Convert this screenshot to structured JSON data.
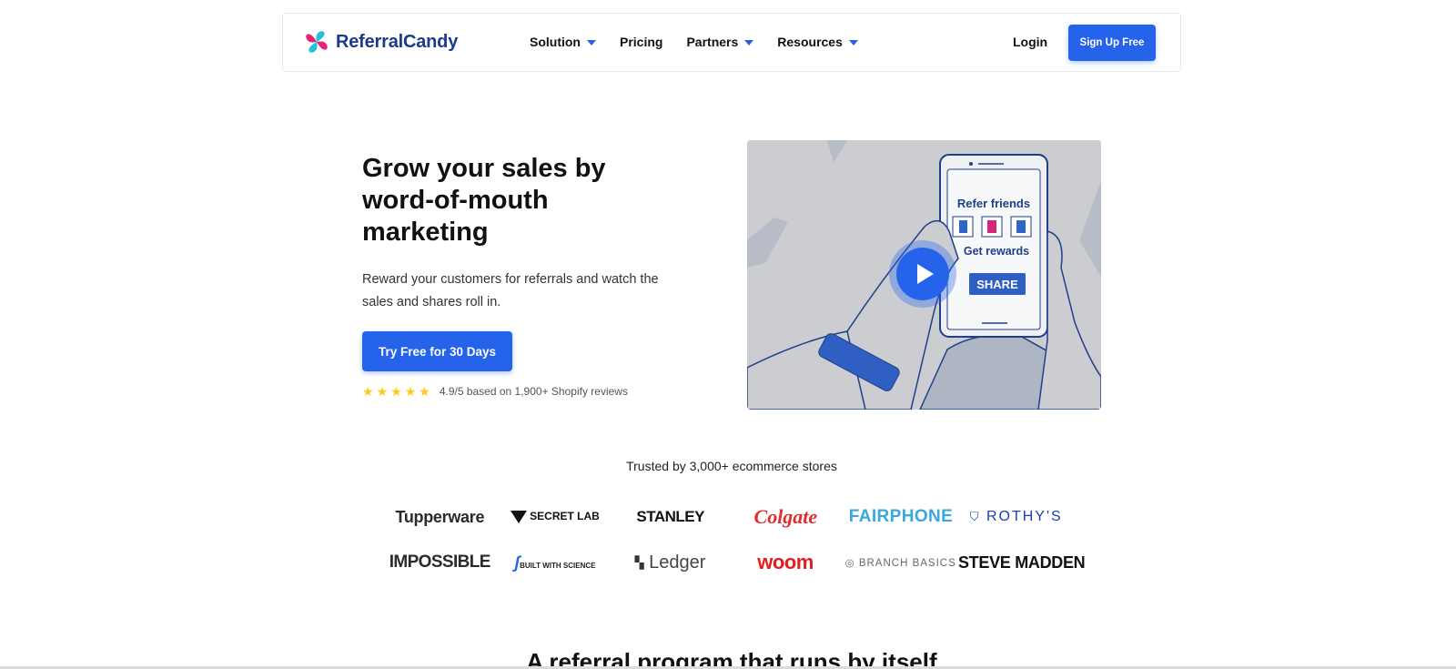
{
  "brand": {
    "name": "ReferralCandy"
  },
  "nav": {
    "items": [
      {
        "label": "Solution",
        "dropdown": true
      },
      {
        "label": "Pricing",
        "dropdown": false
      },
      {
        "label": "Partners",
        "dropdown": true
      },
      {
        "label": "Resources",
        "dropdown": true
      }
    ],
    "login": "Login",
    "signup": "Sign Up Free"
  },
  "hero": {
    "title": "Grow your sales by word-of-mouth marketing",
    "subtitle": "Reward your customers for referrals and watch the sales and shares roll in.",
    "cta": "Try Free for 30 Days",
    "rating": {
      "stars": 5,
      "text": "4.9/5 based on 1,900+ Shopify reviews"
    }
  },
  "video": {
    "phone_heading": "Refer friends",
    "phone_sub": "Get rewards",
    "phone_button": "SHARE"
  },
  "trusted": {
    "heading": "Trusted by 3,000+ ecommerce stores",
    "logos": [
      [
        "Tupperware",
        "SECRET LAB",
        "STANLEY",
        "Colgate",
        "FAIRPHONE",
        "ROTHY'S"
      ],
      [
        "IMPOSSIBLE",
        "BUILT WITH SCIENCE",
        "Ledger",
        "woom",
        "BRANCH BASICS",
        "STEVE MADDEN"
      ]
    ]
  },
  "next_section": {
    "title": "A referral program that runs by itself"
  },
  "colors": {
    "primary": "#2563eb",
    "brand_navy": "#1e3a8a",
    "star": "#facc15",
    "logo_pink": "#e5247a",
    "logo_teal": "#22c3d6"
  }
}
